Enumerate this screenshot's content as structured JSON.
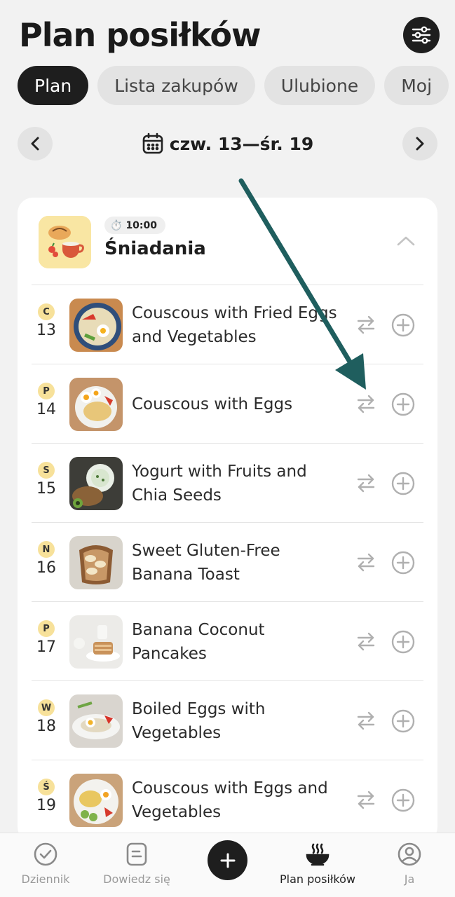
{
  "header": {
    "title": "Plan posiłków",
    "filter_icon": "sliders-icon"
  },
  "tabs": [
    {
      "label": "Plan",
      "active": true
    },
    {
      "label": "Lista zakupów",
      "active": false
    },
    {
      "label": "Ulubione",
      "active": false
    },
    {
      "label": "Moj",
      "active": false
    }
  ],
  "date_nav": {
    "range": "czw. 13—śr. 19",
    "prev_icon": "chevron-left-icon",
    "next_icon": "chevron-right-icon",
    "calendar_icon": "calendar-icon"
  },
  "meal": {
    "time": "10:00",
    "title": "Śniadania",
    "items": [
      {
        "day_letter": "C",
        "day_num": "13",
        "name": "Couscous with Fried Eggs and Vegetables"
      },
      {
        "day_letter": "P",
        "day_num": "14",
        "name": "Couscous with Eggs"
      },
      {
        "day_letter": "S",
        "day_num": "15",
        "name": "Yogurt with Fruits and Chia Seeds"
      },
      {
        "day_letter": "N",
        "day_num": "16",
        "name": "Sweet Gluten-Free Banana Toast"
      },
      {
        "day_letter": "P",
        "day_num": "17",
        "name": "Banana Coconut Pancakes"
      },
      {
        "day_letter": "W",
        "day_num": "18",
        "name": "Boiled Eggs with Vegetables"
      },
      {
        "day_letter": "Ś",
        "day_num": "19",
        "name": "Couscous with Eggs and Vegetables"
      }
    ]
  },
  "bottom_nav": {
    "items": [
      {
        "label": "Dziennik",
        "icon": "check-circle-icon"
      },
      {
        "label": "Dowiedz się",
        "icon": "document-icon"
      },
      {
        "label": "Plan posiłków",
        "icon": "steaming-bowl-icon",
        "active": true
      },
      {
        "label": "Ja",
        "icon": "profile-icon"
      }
    ],
    "fab_icon": "plus-icon"
  },
  "colors": {
    "accent_dark": "#1e1e1e",
    "day_badge": "#f7e19a",
    "annotation_arrow": "#1f5e5e"
  }
}
